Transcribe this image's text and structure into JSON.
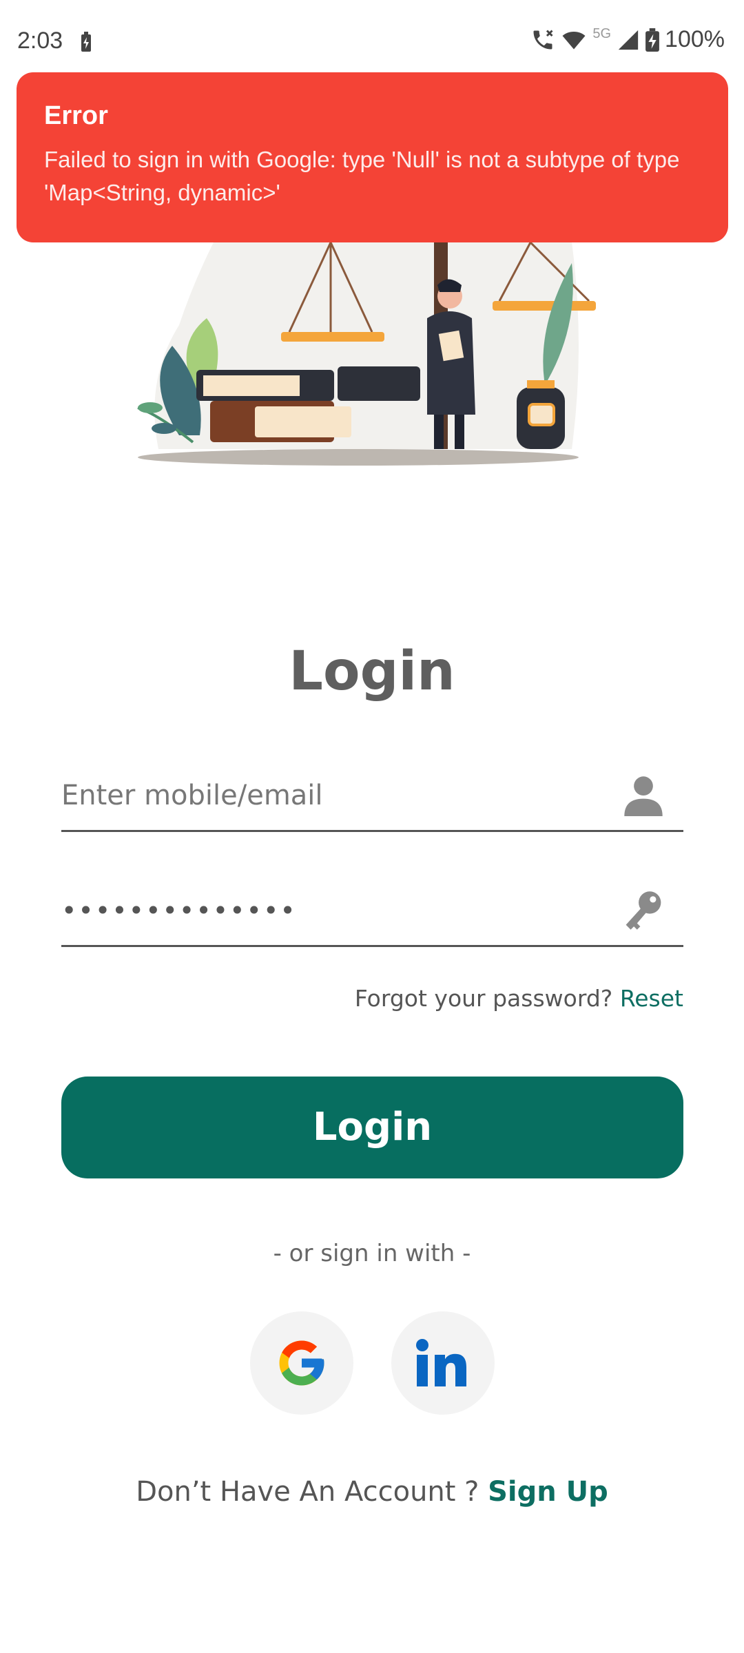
{
  "status_bar": {
    "time": "2:03",
    "battery_percent": "100%",
    "network": "5G"
  },
  "toast": {
    "title": "Error",
    "message": "Failed to sign in with Google: type 'Null' is not a subtype of type 'Map<String, dynamic>'",
    "color": "#F44336"
  },
  "login": {
    "title": "Login",
    "email_placeholder": "Enter mobile/email",
    "password_value": "••••••••••••••",
    "forgot_text": "Forgot your password?",
    "reset_link": "Reset",
    "button_label": "Login",
    "or_text": "- or sign in with -",
    "signup_text": "Don’t Have An Account ?",
    "signup_link": "Sign Up"
  },
  "social": {
    "google_icon": "google-icon",
    "linkedin_icon": "linkedin-icon"
  },
  "colors": {
    "primary": "#076e60",
    "error": "#F44336",
    "link": "#0d6e62"
  }
}
